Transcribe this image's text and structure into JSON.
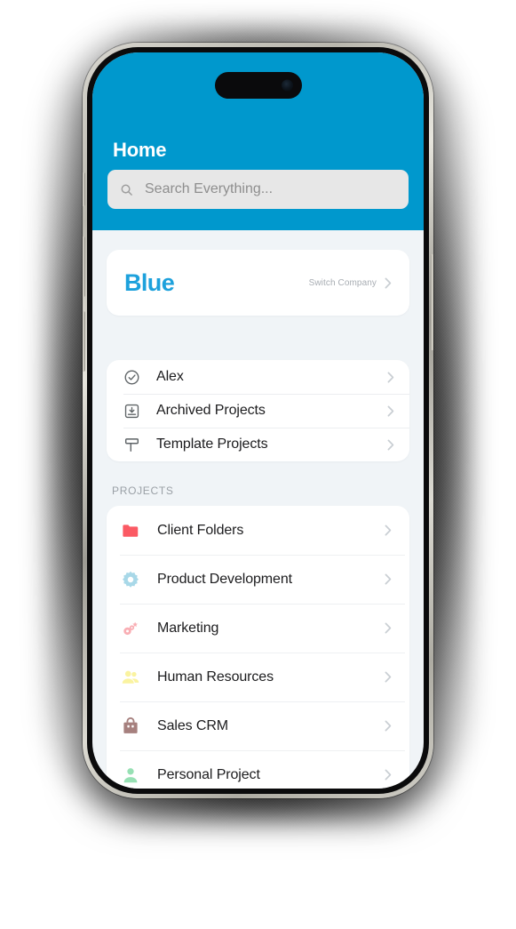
{
  "device": {
    "type": "smartphone",
    "frame_color": "#c8c6be",
    "has_dynamic_island": true
  },
  "header": {
    "title": "Home",
    "background_color": "#0098cd",
    "title_color": "#ffffff"
  },
  "search": {
    "placeholder": "Search Everything...",
    "value": "",
    "icon": "search-icon"
  },
  "company": {
    "name": "Blue",
    "name_color": "#1da1dc",
    "switch_label": "Switch Company",
    "chevron": "chevron-right-icon"
  },
  "menu": {
    "items": [
      {
        "label": "Alex",
        "icon": "check-circle-icon"
      },
      {
        "label": "Archived Projects",
        "icon": "archive-box-icon"
      },
      {
        "label": "Template Projects",
        "icon": "template-icon"
      }
    ]
  },
  "projects": {
    "section_label": "PROJECTS",
    "items": [
      {
        "label": "Client Folders",
        "icon": "folder-icon",
        "icon_color": "#fb5a64"
      },
      {
        "label": "Product Development",
        "icon": "gear-icon",
        "icon_color": "#a8d8e8"
      },
      {
        "label": "Marketing",
        "icon": "gears-sparkle-icon",
        "icon_color": "#f9aeb4"
      },
      {
        "label": "Human Resources",
        "icon": "people-icon",
        "icon_color": "#faf3a0"
      },
      {
        "label": "Sales CRM",
        "icon": "bag-icon",
        "icon_color": "#a6807e"
      },
      {
        "label": "Personal Project",
        "icon": "person-icon",
        "icon_color": "#97e0b4"
      }
    ]
  },
  "colors": {
    "page_background": "#f0f4f7",
    "card_background": "#ffffff",
    "accent": "#0098cd",
    "chevron": "#c9ced3",
    "divider": "#eceef0"
  }
}
